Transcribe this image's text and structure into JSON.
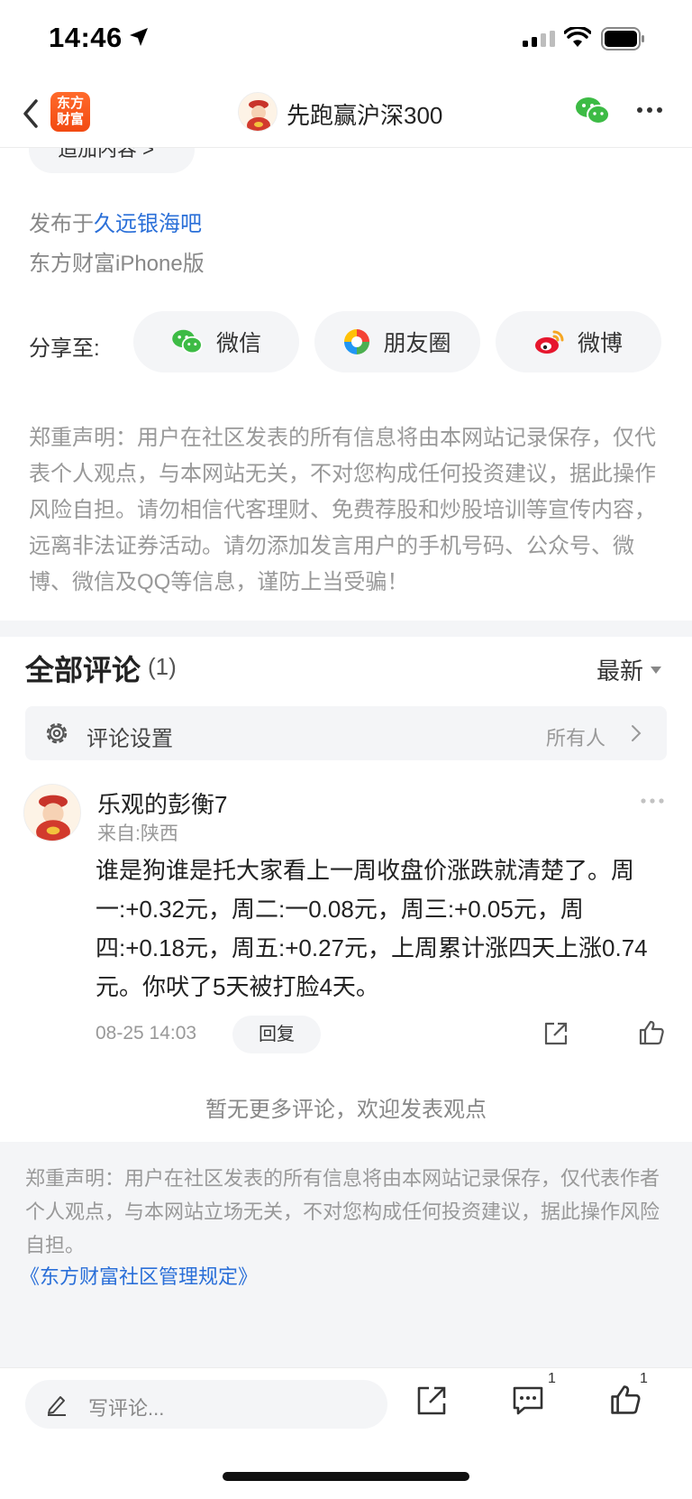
{
  "status_bar": {
    "time": "14:46"
  },
  "nav": {
    "logo_line1": "东方",
    "logo_line2": "财富",
    "title": "先跑赢沪深300"
  },
  "post": {
    "add_content_label": "追加内容 >",
    "publish_prefix": "发布于",
    "publish_bar": "久远银海吧",
    "client": "东方财富iPhone版"
  },
  "share": {
    "label": "分享至:",
    "options": [
      {
        "label": "微信",
        "icon": "wechat-icon"
      },
      {
        "label": "朋友圈",
        "icon": "moments-icon"
      },
      {
        "label": "微博",
        "icon": "weibo-icon"
      }
    ]
  },
  "disclaimer_top": "郑重声明：用户在社区发表的所有信息将由本网站记录保存，仅代表个人观点，与本网站无关，不对您构成任何投资建议，据此操作风险自担。请勿相信代客理财、免费荐股和炒股培训等宣传内容，远离非法证券活动。请勿添加发言用户的手机号码、公众号、微博、微信及QQ等信息，谨防上当受骗！",
  "comments": {
    "title": "全部评论",
    "count": "(1)",
    "sort": "最新",
    "settings_label": "评论设置",
    "settings_value": "所有人",
    "items": [
      {
        "user": "乐观的彭衡7",
        "location": "来自:陕西",
        "body": "谁是狗谁是托大家看上一周收盘价涨跌就清楚了。周一:+0.32元，周二:一0.08元，周三:+0.05元，周四:+0.18元，周五:+0.27元，上周累计涨四天上涨0.74元。你吠了5天被打脸4天。",
        "time": "08-25 14:03",
        "reply_label": "回复"
      }
    ],
    "no_more": "暂无更多评论，欢迎发表观点"
  },
  "footer": {
    "disclaimer": "郑重声明：用户在社区发表的所有信息将由本网站记录保存，仅代表作者个人观点，与本网站立场无关，不对您构成任何投资建议，据此操作风险自担。",
    "rules_link": "《东方财富社区管理规定》"
  },
  "bottom_bar": {
    "input_placeholder": "写评论...",
    "comment_count": "1",
    "like_count": "1"
  },
  "colors": {
    "link": "#2a6fd8",
    "brand": "#f24a12",
    "panel_bg": "#f4f5f7"
  }
}
